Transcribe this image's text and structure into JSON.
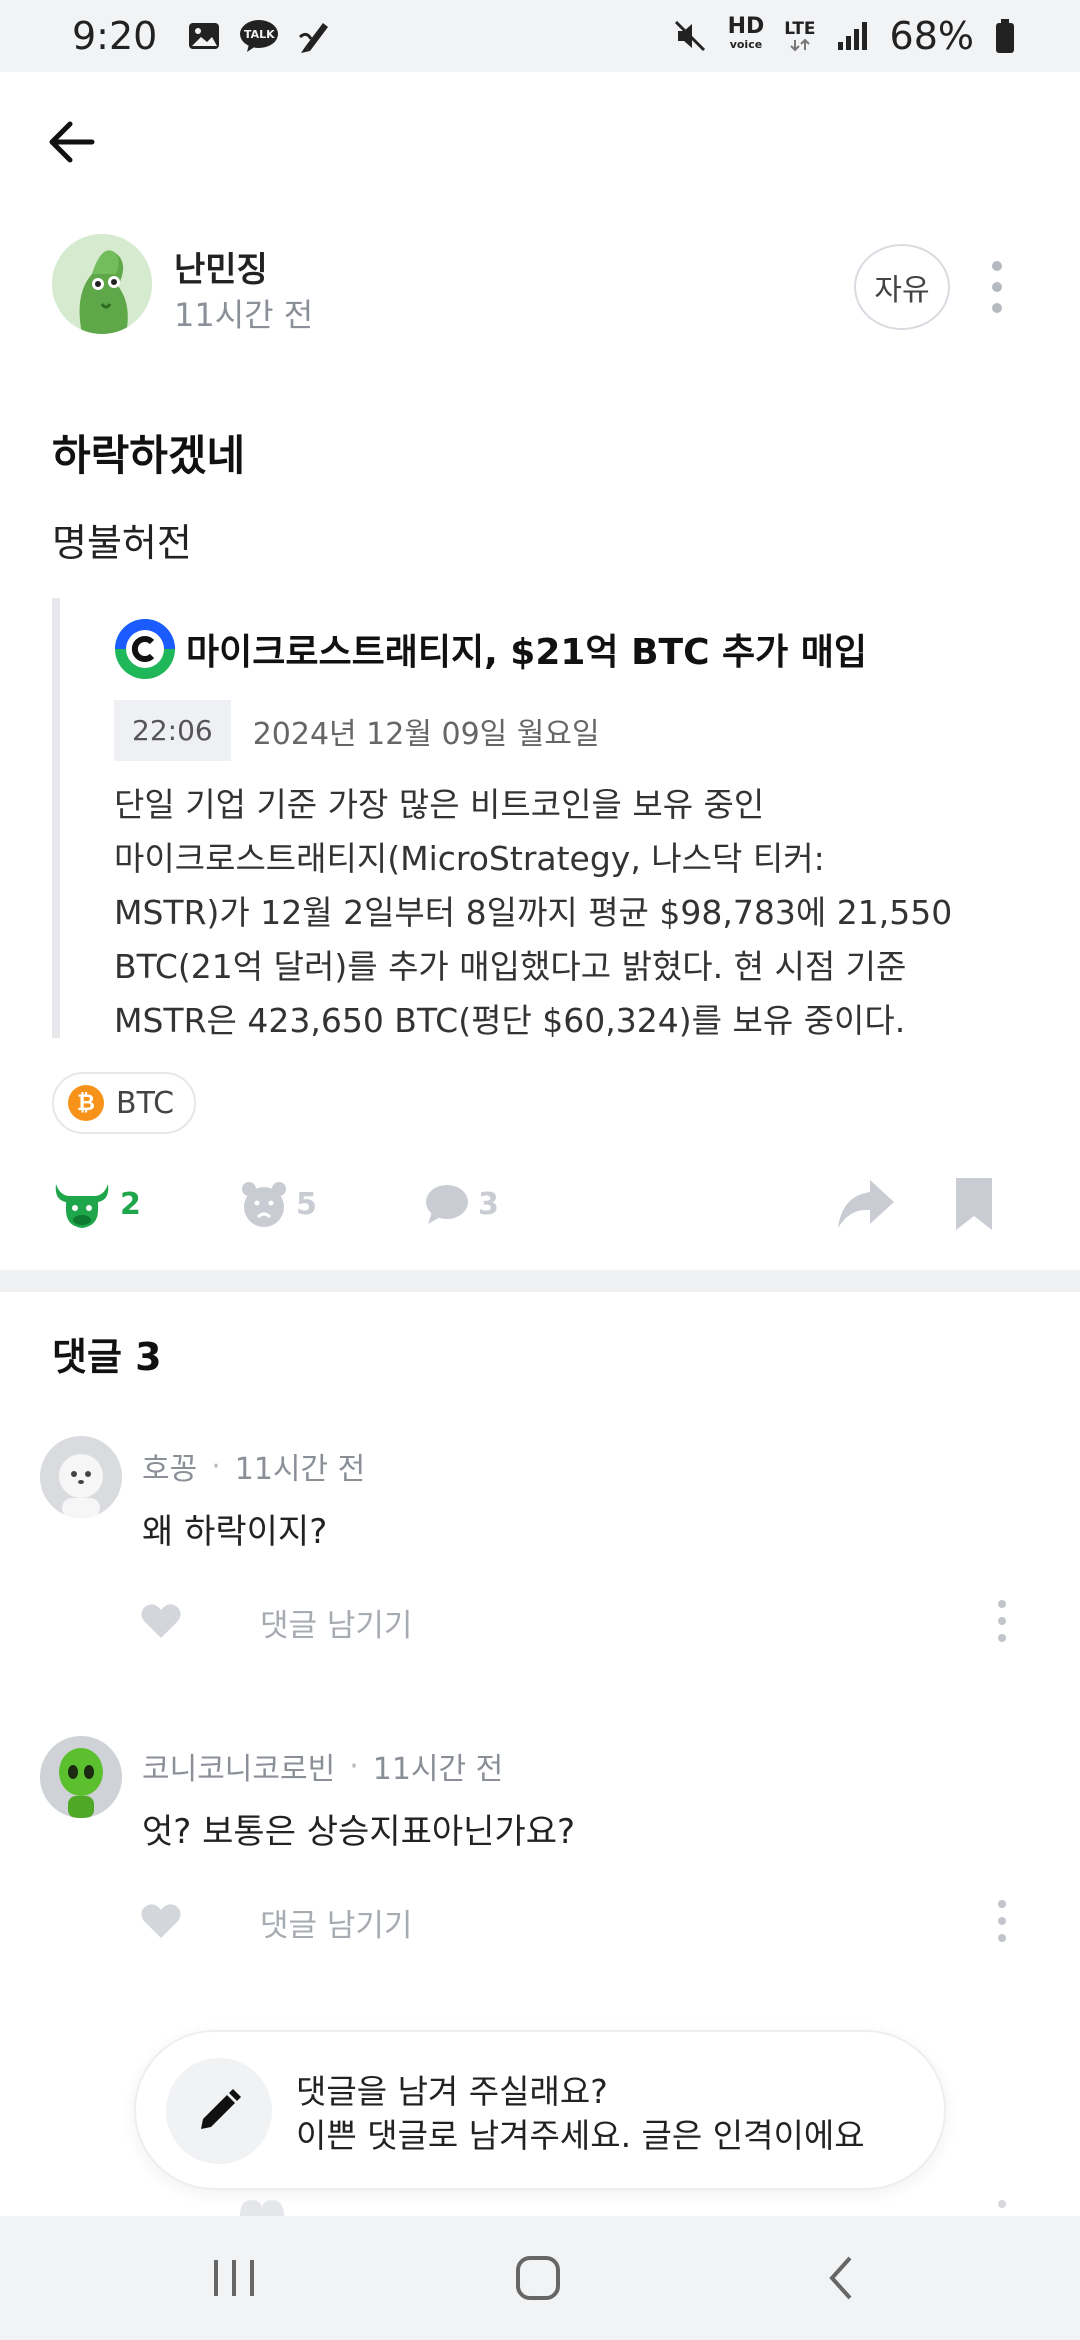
{
  "status_bar": {
    "time": "9:20",
    "talk_label": "TALK",
    "hd_label": "HD",
    "voice_label": "voice",
    "lte_label": "LTE",
    "battery": "68%",
    "icons": [
      "gallery-icon",
      "kakaotalk-icon",
      "pen-icon",
      "mute-icon",
      "signal-icon",
      "battery-icon"
    ]
  },
  "post": {
    "author": "난민징",
    "time": "11시간 전",
    "tag": "자유",
    "title": "하락하겠네",
    "body": "명불허전",
    "quote": {
      "title": "마이크로스트래티지, $21억 BTC 추가 매입",
      "time": "22:06",
      "date": "2024년 12월 09일 월요일",
      "lines": [
        "단일 기업 기준 가장 많은 비트코인을 보유 중인",
        "마이크로스트래티지(MicroStrategy, 나스닥 티커:",
        "MSTR)가 12월 2일부터 8일까지 평균 $98,783에 21,550",
        "BTC(21억 달러)를 추가 매입했다고 밝혔다.  현 시점 기준",
        "MSTR은 423,650 BTC(평단 $60,324)를 보유 중이다."
      ]
    },
    "coin": {
      "label": "BTC",
      "icon": "bitcoin-icon",
      "color": "#f7931a"
    },
    "reactions": {
      "bull_count": "2",
      "bear_count": "5",
      "comment_count": "3"
    }
  },
  "comments_section": {
    "title": "댓글 3",
    "reply_label": "댓글 남기기",
    "comments": [
      {
        "author": "호꽁",
        "separator": "·",
        "time": "11시간 전",
        "text": "왜 하락이지?"
      },
      {
        "author": "코니코니코로빈",
        "separator": "·",
        "time": "11시간 전",
        "text": "엇? 보통은 상승지표아닌가요?"
      }
    ]
  },
  "composer": {
    "line1": "댓글을 남겨 주실래요?",
    "line2": "이쁜 댓글로 남겨주세요. 글은 인격이에요"
  },
  "colors": {
    "bull": "#1fa64a",
    "inactive": "#c9ccd2",
    "accent_logo": "#1a5cff"
  }
}
